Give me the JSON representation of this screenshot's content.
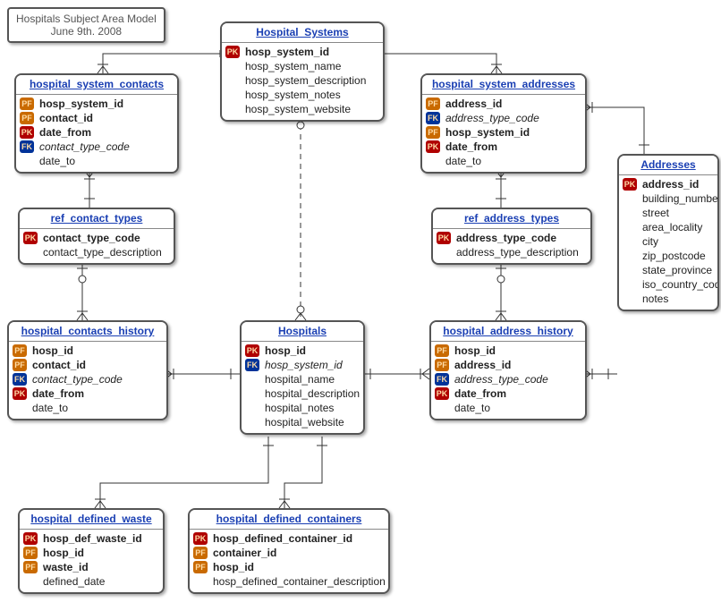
{
  "title": {
    "line1": "Hospitals Subject Area Model",
    "line2": "June 9th. 2008"
  },
  "entities": {
    "hospital_systems": {
      "name": "Hospital_Systems",
      "fields": [
        {
          "key": "PK",
          "label": "hosp_system_id",
          "bold": true
        },
        {
          "key": "",
          "label": "hosp_system_name"
        },
        {
          "key": "",
          "label": "hosp_system_description"
        },
        {
          "key": "",
          "label": "hosp_system_notes"
        },
        {
          "key": "",
          "label": "hosp_system_website"
        }
      ]
    },
    "hospital_system_contacts": {
      "name": "hospital_system_contacts",
      "fields": [
        {
          "key": "PF",
          "label": "hosp_system_id",
          "bold": true
        },
        {
          "key": "PF",
          "label": "contact_id",
          "bold": true
        },
        {
          "key": "PK",
          "label": "date_from",
          "bold": true
        },
        {
          "key": "FK",
          "label": "contact_type_code",
          "italic": true
        },
        {
          "key": "",
          "label": "date_to"
        }
      ]
    },
    "ref_contact_types": {
      "name": "ref_contact_types",
      "fields": [
        {
          "key": "PK",
          "label": "contact_type_code",
          "bold": true
        },
        {
          "key": "",
          "label": "contact_type_description"
        }
      ]
    },
    "hospital_contacts_history": {
      "name": "hospital_contacts_history",
      "fields": [
        {
          "key": "PF",
          "label": "hosp_id",
          "bold": true
        },
        {
          "key": "PF",
          "label": "contact_id",
          "bold": true
        },
        {
          "key": "FK",
          "label": "contact_type_code",
          "italic": true
        },
        {
          "key": "PK",
          "label": "date_from",
          "bold": true
        },
        {
          "key": "",
          "label": "date_to"
        }
      ]
    },
    "hospitals": {
      "name": "Hospitals",
      "fields": [
        {
          "key": "PK",
          "label": "hosp_id",
          "bold": true
        },
        {
          "key": "FK",
          "label": "hosp_system_id",
          "italic": true
        },
        {
          "key": "",
          "label": "hospital_name"
        },
        {
          "key": "",
          "label": "hospital_description"
        },
        {
          "key": "",
          "label": "hospital_notes"
        },
        {
          "key": "",
          "label": "hospital_website"
        }
      ]
    },
    "hospital_system_addresses": {
      "name": "hospital_system_addresses",
      "fields": [
        {
          "key": "PF",
          "label": "address_id",
          "bold": true
        },
        {
          "key": "FK",
          "label": "address_type_code",
          "italic": true
        },
        {
          "key": "PF",
          "label": "hosp_system_id",
          "bold": true
        },
        {
          "key": "PK",
          "label": "date_from",
          "bold": true
        },
        {
          "key": "",
          "label": "date_to"
        }
      ]
    },
    "ref_address_types": {
      "name": "ref_address_types",
      "fields": [
        {
          "key": "PK",
          "label": "address_type_code",
          "bold": true
        },
        {
          "key": "",
          "label": "address_type_description"
        }
      ]
    },
    "hospital_address_history": {
      "name": "hospital_address_history",
      "fields": [
        {
          "key": "PF",
          "label": "hosp_id",
          "bold": true
        },
        {
          "key": "PF",
          "label": "address_id",
          "bold": true
        },
        {
          "key": "FK",
          "label": "address_type_code",
          "italic": true
        },
        {
          "key": "PK",
          "label": "date_from",
          "bold": true
        },
        {
          "key": "",
          "label": "date_to"
        }
      ]
    },
    "addresses": {
      "name": "Addresses",
      "fields": [
        {
          "key": "PK",
          "label": "address_id",
          "bold": true
        },
        {
          "key": "",
          "label": "building_number"
        },
        {
          "key": "",
          "label": "street"
        },
        {
          "key": "",
          "label": "area_locality"
        },
        {
          "key": "",
          "label": "city"
        },
        {
          "key": "",
          "label": "zip_postcode"
        },
        {
          "key": "",
          "label": "state_province"
        },
        {
          "key": "",
          "label": "iso_country_code"
        },
        {
          "key": "",
          "label": "notes"
        }
      ]
    },
    "hospital_defined_waste": {
      "name": "hospital_defined_waste",
      "fields": [
        {
          "key": "PK",
          "label": "hosp_def_waste_id",
          "bold": true
        },
        {
          "key": "PF",
          "label": "hosp_id",
          "bold": true
        },
        {
          "key": "PF",
          "label": "waste_id",
          "bold": true
        },
        {
          "key": "",
          "label": "defined_date"
        }
      ]
    },
    "hospital_defined_containers": {
      "name": "hospital_defined_containers",
      "fields": [
        {
          "key": "PK",
          "label": "hosp_defined_container_id",
          "bold": true
        },
        {
          "key": "PF",
          "label": "container_id",
          "bold": true
        },
        {
          "key": "PF",
          "label": "hosp_id",
          "bold": true
        },
        {
          "key": "",
          "label": "hosp_defined_container_description"
        }
      ]
    }
  }
}
